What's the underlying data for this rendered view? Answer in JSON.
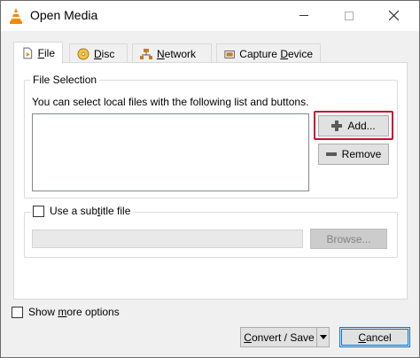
{
  "window": {
    "title": "Open Media"
  },
  "tabs": [
    {
      "prefix": "",
      "accel": "F",
      "rest": "ile",
      "icon": "file-icon",
      "active": true
    },
    {
      "prefix": "",
      "accel": "D",
      "rest": "isc",
      "icon": "disc-icon",
      "active": false
    },
    {
      "prefix": "",
      "accel": "N",
      "rest": "etwork",
      "icon": "network-icon",
      "active": false
    },
    {
      "prefix": "Capture ",
      "accel": "D",
      "rest": "evice",
      "icon": "capture-device-icon",
      "active": false
    }
  ],
  "file_selection": {
    "legend": "File Selection",
    "description": "You can select local files with the following list and buttons.",
    "files": [],
    "add_label": "Add...",
    "remove_label": "Remove"
  },
  "subtitle": {
    "checkbox_label_prefix": "Use a sub",
    "checkbox_label_accel": "t",
    "checkbox_label_rest": "itle file",
    "checked": false,
    "path_value": "",
    "browse_label": "Browse..."
  },
  "footer": {
    "more_options_prefix": "Show ",
    "more_options_accel": "m",
    "more_options_rest": "ore options",
    "more_options_checked": false,
    "convert_accel": "C",
    "convert_rest": "onvert / Save",
    "cancel_accel": "C",
    "cancel_rest": "ancel"
  },
  "colors": {
    "highlight": "#c8102e",
    "vlc_orange": "#f08a00",
    "focus_blue": "#0078d7"
  }
}
